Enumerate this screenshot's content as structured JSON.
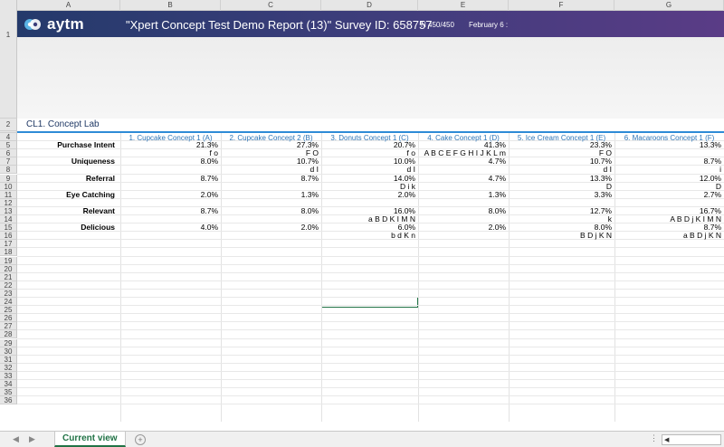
{
  "columns": [
    "A",
    "B",
    "C",
    "D",
    "E",
    "F",
    "G"
  ],
  "row_numbers": [
    "1",
    "2",
    "3",
    "4",
    "5",
    "6",
    "7",
    "8",
    "9",
    "10",
    "11",
    "12",
    "13",
    "14",
    "15",
    "16",
    "17",
    "18",
    "19",
    "20",
    "21",
    "22",
    "23",
    "24",
    "25",
    "26",
    "27",
    "28",
    "29",
    "30",
    "31",
    "32",
    "33",
    "34",
    "35",
    "36"
  ],
  "banner": {
    "logo_text": "aytm",
    "title": "\"Xpert Concept Test Demo Report (13)\" Survey ID: 658757",
    "n": "N 450/450",
    "date": "February 6 :"
  },
  "section_title": "CL1. Concept Lab",
  "table": {
    "headers": [
      "1. Cupcake Concept 1 (A)",
      "2. Cupcake Concept 2 (B)",
      "3. Donuts Concept 1 (C)",
      "4. Cake Concept 1 (D)",
      "5. Ice Cream Concept 1 (E)",
      "6. Macaroons Concept 1 (F)"
    ],
    "rows": [
      {
        "label": "Purchase Intent",
        "values": [
          "21.3%",
          "27.3%",
          "20.7%",
          "41.3%",
          "23.3%",
          "13.3%"
        ],
        "sig": [
          "f o",
          "F O",
          "f o",
          "A B C E F G H I J K L m",
          "F O",
          ""
        ]
      },
      {
        "label": "Uniqueness",
        "values": [
          "8.0%",
          "10.7%",
          "10.0%",
          "4.7%",
          "10.7%",
          "8.7%"
        ],
        "sig": [
          "",
          "d I",
          "d I",
          "",
          "d I",
          "i"
        ]
      },
      {
        "label": "Referral",
        "values": [
          "8.7%",
          "8.7%",
          "14.0%",
          "4.7%",
          "13.3%",
          "12.0%"
        ],
        "sig": [
          "",
          "",
          "D i k",
          "",
          "D",
          "D"
        ]
      },
      {
        "label": "Eye Catching",
        "values": [
          "2.0%",
          "1.3%",
          "2.0%",
          "1.3%",
          "3.3%",
          "2.7%"
        ],
        "sig": [
          "",
          "",
          "",
          "",
          "",
          ""
        ]
      },
      {
        "label": "Relevant",
        "values": [
          "8.7%",
          "8.0%",
          "16.0%",
          "8.0%",
          "12.7%",
          "16.7%"
        ],
        "sig": [
          "",
          "",
          "a B D K I M N",
          "",
          "k",
          "A B D j K I M N"
        ]
      },
      {
        "label": "Delicious",
        "values": [
          "4.0%",
          "2.0%",
          "6.0%",
          "2.0%",
          "8.0%",
          "8.7%"
        ],
        "sig": [
          "",
          "",
          "b d K n",
          "",
          "B D j K N",
          "a B D j K N"
        ]
      }
    ]
  },
  "sheet_tab": "Current view",
  "add_sheet_symbol": "+",
  "colors": {
    "accent": "#217346",
    "header_blue": "#2e75b6",
    "banner_start": "#243a6b",
    "banner_end": "#5a3c86"
  }
}
